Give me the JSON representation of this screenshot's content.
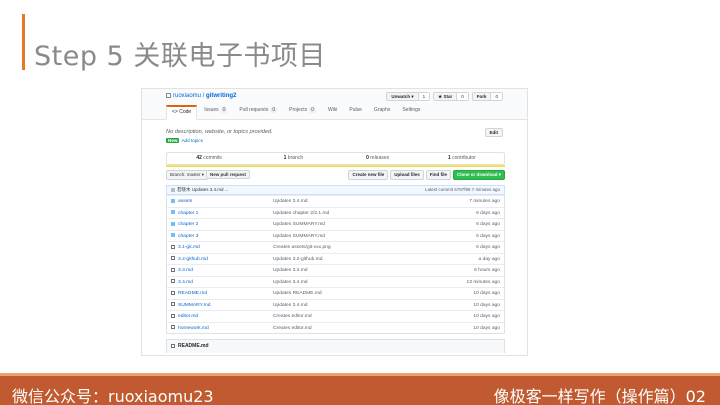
{
  "slide": {
    "title": "Step 5 关联电子书项目",
    "footer_left": "微信公众号：ruoxiaomu23",
    "footer_right": "像极客一样写作（操作篇）02"
  },
  "repo": {
    "owner": "ruoxiaomu",
    "separator": " / ",
    "name": "gitwriting2",
    "unwatch_label": "Unwatch ▾",
    "unwatch_count": "1",
    "star_label": "★ Star",
    "star_count": "0",
    "fork_label": "Fork",
    "fork_count": "0"
  },
  "tabs": [
    {
      "label": "<> Code",
      "badge": ""
    },
    {
      "label": "Issues",
      "badge": "0"
    },
    {
      "label": "Pull requests",
      "badge": "0"
    },
    {
      "label": "Projects",
      "badge": "0"
    },
    {
      "label": "Wiki",
      "badge": ""
    },
    {
      "label": "Pulse",
      "badge": ""
    },
    {
      "label": "Graphs",
      "badge": ""
    },
    {
      "label": "Settings",
      "badge": ""
    }
  ],
  "description": {
    "text": "No description, website, or topics provided.",
    "edit_label": "Edit",
    "new_tag": "New",
    "topics_link": "Add topics"
  },
  "stats": {
    "commits_count": "42",
    "commits_label": " commits",
    "branch_count": "1",
    "branch_label": " branch",
    "releases_count": "0",
    "releases_label": " releases",
    "contributor_count": "1",
    "contributor_label": " contributor"
  },
  "file_nav": {
    "branch_label": "Branch: master ▾",
    "new_pr_label": "New pull request",
    "create_file": "Create new file",
    "upload_files": "Upload files",
    "find_file": "Find file",
    "clone_label": "Clone or download ▾"
  },
  "latest_commit": {
    "author": "若晓木",
    "message": "Updates 3.4.md",
    "ellipsis": "...",
    "right": "Latest commit 5787f98  7 minutes ago"
  },
  "files": [
    {
      "type": "folder",
      "name": "assets",
      "message": "Updates 3.4.md",
      "age": "7 minutes ago"
    },
    {
      "type": "folder",
      "name": "chapter 1",
      "message": "Updates chapter 2/2.1.md",
      "age": "6 days ago"
    },
    {
      "type": "folder",
      "name": "chapter 2",
      "message": "Updates SUMMARY.md",
      "age": "6 days ago"
    },
    {
      "type": "folder",
      "name": "chapter 3",
      "message": "Updates SUMMARY.md",
      "age": "6 days ago"
    },
    {
      "type": "file",
      "name": "3.1-git.md",
      "message": "Creates assets/git-xxx.png",
      "age": "6 days ago"
    },
    {
      "type": "file",
      "name": "3.2-github.md",
      "message": "Updates 3.2-github.md",
      "age": "a day ago"
    },
    {
      "type": "file",
      "name": "3.3.md",
      "message": "Updates 3.3.md",
      "age": "6 hours ago"
    },
    {
      "type": "file",
      "name": "3.4.md",
      "message": "Updates 3.4.md",
      "age": "13 minutes ago"
    },
    {
      "type": "file",
      "name": "README.md",
      "message": "Updates README.md",
      "age": "10 days ago"
    },
    {
      "type": "file",
      "name": "SUMMARY.md",
      "message": "Updates 3.4.md",
      "age": "10 days ago"
    },
    {
      "type": "file",
      "name": "editor.md",
      "message": "Creates editor.md",
      "age": "10 days ago"
    },
    {
      "type": "file",
      "name": "homework.md",
      "message": "Creates editor.md",
      "age": "10 days ago"
    }
  ],
  "readme_header": "README.md"
}
